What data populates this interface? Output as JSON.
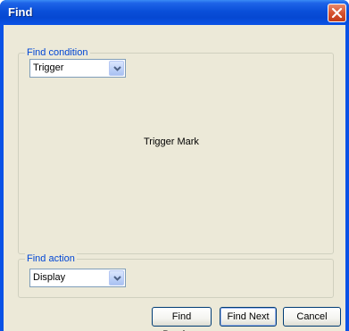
{
  "window": {
    "title": "Find"
  },
  "find_condition": {
    "legend": "Find condition",
    "selected": "Trigger",
    "info_text": "Trigger Mark"
  },
  "find_action": {
    "legend": "Find action",
    "selected": "Display"
  },
  "buttons": {
    "find_previous": "Find Previous",
    "find_next": "Find Next",
    "cancel": "Cancel"
  },
  "icons": {
    "close": "close-icon",
    "dropdown": "chevron-down-icon"
  },
  "colors": {
    "titlebar": "#0a52e6",
    "client_bg": "#ece9d8",
    "close_button": "#d6532f",
    "group_legend": "#0046d5"
  }
}
